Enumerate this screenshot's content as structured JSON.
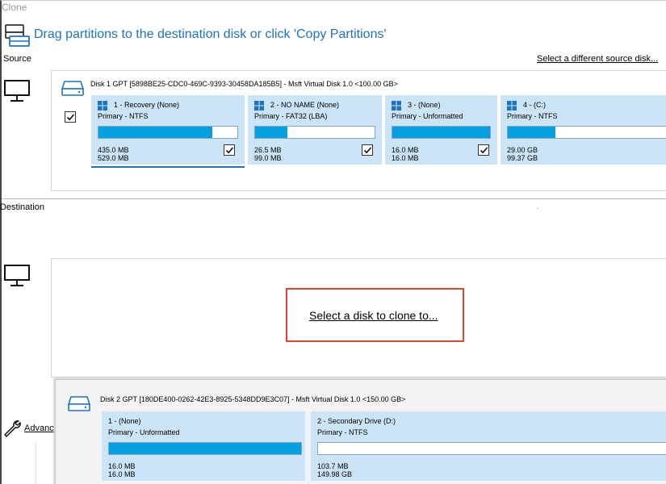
{
  "window": {
    "title": "Clone"
  },
  "header": {
    "instruction": "Drag partitions to the destination disk or click 'Copy Partitions'"
  },
  "source": {
    "label": "Source",
    "change_link": "Select a different source disk...",
    "disk": {
      "title": "Disk 1 GPT [5898BE25-CDC0-469C-9393-30458DA185B5] - Msft    Virtual Disk    1.0  <100.00 GB>",
      "checked": true,
      "partitions": [
        {
          "name": "1 - Recovery (None)",
          "type": "Primary - NTFS",
          "used": "435.0 MB",
          "total": "529.0 MB",
          "fill": 0.82,
          "checked": true
        },
        {
          "name": "2 - NO NAME (None)",
          "type": "Primary - FAT32 (LBA)",
          "used": "26.5 MB",
          "total": "99.0 MB",
          "fill": 0.27,
          "checked": true
        },
        {
          "name": "3 -  (None)",
          "type": "Primary - Unformatted",
          "used": "16.0 MB",
          "total": "16.0 MB",
          "fill": 1.0,
          "checked": true
        },
        {
          "name": "4 -  (C:)",
          "type": "Primary - NTFS",
          "used": "29.00 GB",
          "total": "99.37 GB",
          "fill": 0.29
        }
      ]
    }
  },
  "destination": {
    "label": "Destination",
    "select_link": "Select a disk to clone to..."
  },
  "footer": {
    "advanced_link": "Advanc"
  },
  "popup_disk": {
    "title": "Disk 2 GPT [180DE400-0262-42E3-8925-5348DD9E3C07] - Msft    Virtual Disk    1.0  <150.00 GB>",
    "partitions": [
      {
        "name": "1 -  (None)",
        "type": "Primary - Unformatted",
        "used": "16.0 MB",
        "total": "16.0 MB",
        "fill": 1.0
      },
      {
        "name": "2 - Secondary Drive (D:)",
        "type": "Primary - NTFS",
        "used": "103.7 MB",
        "total": "149.98 GB",
        "fill": 0.0
      }
    ]
  },
  "colors": {
    "accent": "#1e73be",
    "bar_fill": "#06a0e0",
    "partition_bg": "#cce4f7",
    "highlight_box": "#e0442c"
  },
  "icons": [
    "disk-stack-icon",
    "monitor-icon",
    "hard-disk-icon",
    "windows-logo-icon",
    "checkmark-icon",
    "wrench-icon"
  ]
}
